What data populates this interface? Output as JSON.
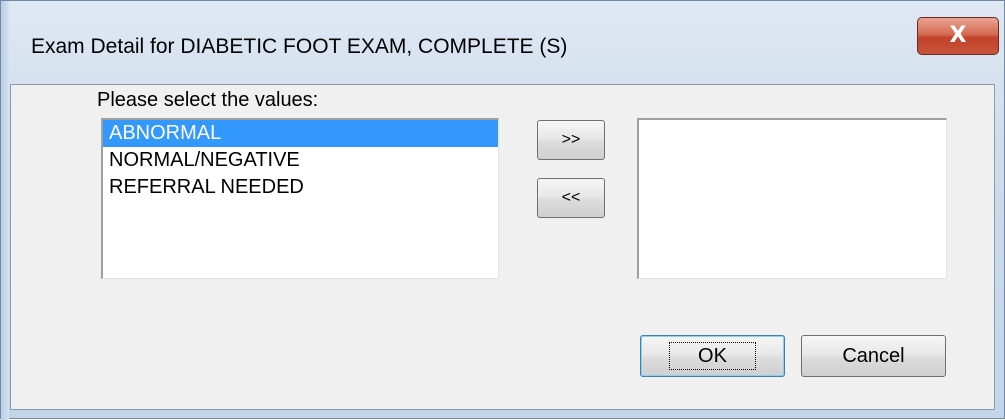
{
  "window": {
    "title": "Exam Detail for  DIABETIC FOOT EXAM, COMPLETE (S)",
    "close_label": "X"
  },
  "prompt": "Please select the values:",
  "available_list": {
    "items": [
      {
        "label": "ABNORMAL",
        "selected": true
      },
      {
        "label": "NORMAL/NEGATIVE",
        "selected": false
      },
      {
        "label": "REFERRAL NEEDED",
        "selected": false
      }
    ]
  },
  "selected_list": {
    "items": []
  },
  "buttons": {
    "add_label": ">>",
    "remove_label": "<<",
    "ok_label": "OK",
    "cancel_label": "Cancel"
  },
  "colors": {
    "selection": "#3399ff",
    "dialog_background": "#f0f0f0",
    "close_button": "#c8543a"
  },
  "icons": {
    "close": "close-icon"
  }
}
